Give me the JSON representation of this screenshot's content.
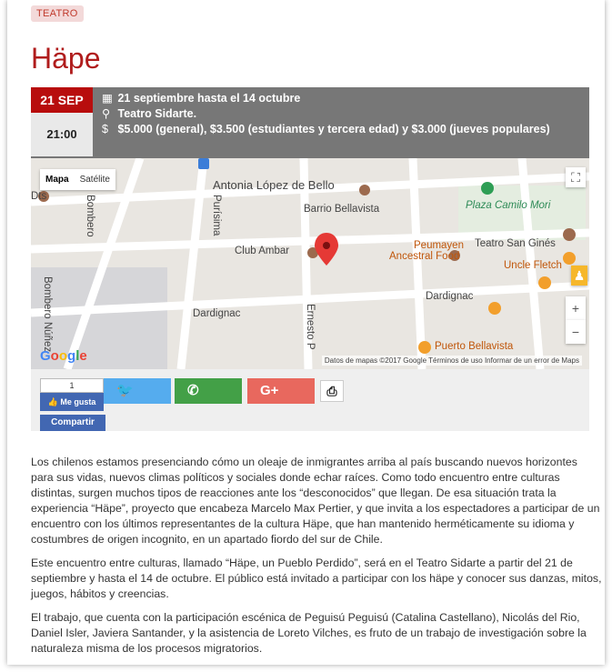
{
  "event": {
    "category": "TEATRO",
    "title": "Häpe",
    "date_badge": "21 SEP",
    "time": "21:00",
    "info": {
      "dates": "21 septiembre hasta el 14 octubre",
      "venue": "Teatro Sidarte.",
      "price": "$5.000 (general), $3.500 (estudiantes y tercera edad) y $3.000 (jueves populares)"
    }
  },
  "icons": {
    "calendar": "calendar-icon",
    "location": "map-pin-icon",
    "price": "dollar-icon"
  },
  "map": {
    "type_buttons": [
      "Mapa",
      "Satélite"
    ],
    "labels": {
      "dts": "Dts",
      "antonia": "Antonia López de Bello",
      "barrio": "Barrio Bellavista",
      "plaza": "Plaza Camilo Mori",
      "club": "Club Ambar",
      "peumayen_1": "Peumayen",
      "peumayen_2": "Ancestral Food",
      "sanGines": "Teatro San Ginés",
      "uncle": "Uncle Fletch",
      "bombero": "Bombero Núñez",
      "dardignac_left": "Dardignac",
      "dardignac_right": "Dardignac",
      "purisima": "Purísima",
      "ernesto": "Ernesto P",
      "puerto": "Puerto Bellavista",
      "bombero_top": "Bombero"
    },
    "google": "Google",
    "footer": "Datos de mapas ©2017 Google   Términos de uso   Informar de un error de Maps"
  },
  "share": {
    "like_count": "1",
    "like_label": "Me gusta",
    "share_label": "Compartir",
    "gplus_label": "G+"
  },
  "article": {
    "paragraphs": [
      "Los chilenos estamos presenciando cómo un oleaje de inmigrantes arriba al país buscando nuevos horizontes para sus vidas, nuevos climas políticos y sociales donde echar raíces. Como todo encuentro entre culturas distintas, surgen muchos tipos de reacciones ante los “desconocidos” que llegan. De esa situación trata la experiencia “Häpe”, proyecto que encabeza Marcelo Max Pertier, y que invita a los espectadores a participar de un encuentro con los últimos representantes de la cultura Häpe, que han mantenido herméticamente su idioma y costumbres de origen incognito, en un apartado fiordo del sur de Chile.",
      "Este encuentro entre culturas, llamado “Häpe, un Pueblo Perdido”, será en el Teatro Sidarte a partir del 21 de septiembre y hasta el 14 de octubre. El público está invitado a participar con los häpe y conocer sus danzas, mitos, juegos, hábitos y creencias.",
      "El trabajo, que cuenta con la participación escénica de Peguisú Peguisú (Catalina Castellano), Nicolás del Rio, Daniel Isler, Javiera Santander, y la asistencia de Loreto Vilches, es fruto de un trabajo de investigación sobre la naturaleza misma de los procesos migratorios."
    ]
  }
}
